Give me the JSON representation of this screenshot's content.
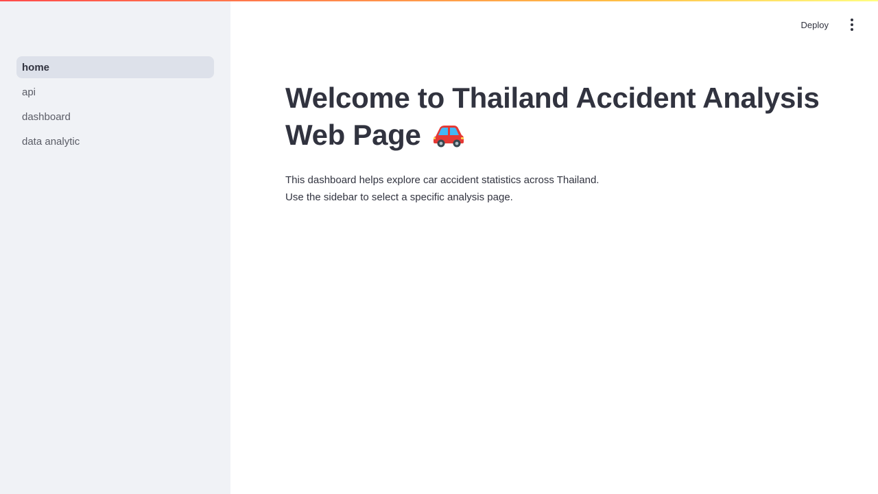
{
  "sidebar": {
    "items": [
      {
        "label": "home",
        "active": true
      },
      {
        "label": "api",
        "active": false
      },
      {
        "label": "dashboard",
        "active": false
      },
      {
        "label": "data analytic",
        "active": false
      }
    ]
  },
  "header": {
    "deploy_label": "Deploy",
    "menu_icon": "more-vertical-icon"
  },
  "main": {
    "title": "Welcome to Thailand Accident Analysis Web Page",
    "title_icon": "car-icon",
    "description_lines": [
      "This dashboard helps explore car accident statistics across Thailand.",
      "Use the sidebar to select a specific analysis page."
    ]
  },
  "colors": {
    "sidebar_bg": "#f0f2f6",
    "active_item_bg": "#dde1ea",
    "text": "#31333f",
    "accent_gradient_start": "#ff4b4b",
    "accent_gradient_end": "#fffd80"
  }
}
